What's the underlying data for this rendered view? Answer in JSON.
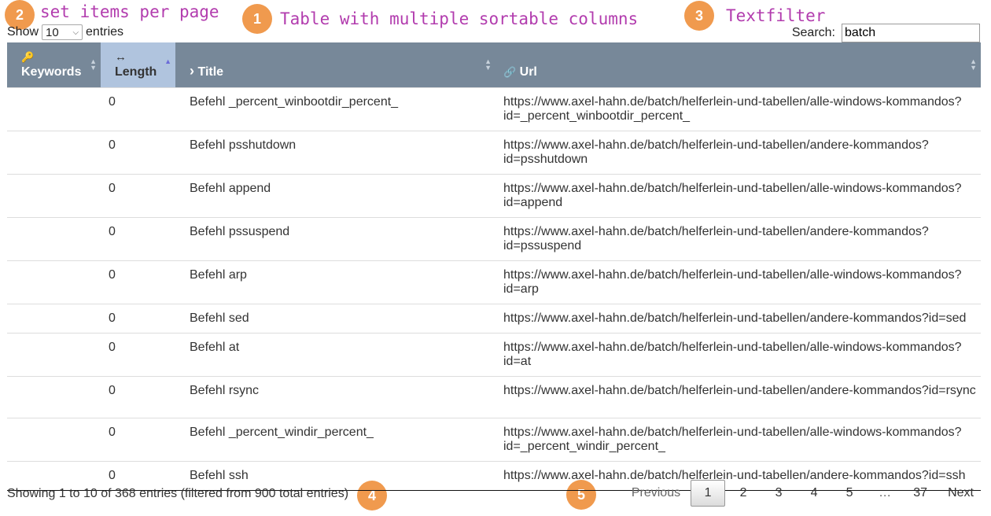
{
  "annotations": [
    {
      "num": "2",
      "text": "set items per page"
    },
    {
      "num": "1",
      "text": "Table with multiple sortable columns"
    },
    {
      "num": "3",
      "text": "Textfilter"
    },
    {
      "num": "4",
      "text": ""
    },
    {
      "num": "5",
      "text": ""
    }
  ],
  "length": {
    "label_pre": "Show",
    "value": "10",
    "label_post": "entries"
  },
  "search": {
    "label": "Search:",
    "value": "batch"
  },
  "columns": [
    {
      "label": "Keywords",
      "icon": "key-icon",
      "glyph": "🔑",
      "sorted": false
    },
    {
      "label": "Length",
      "icon": "arrows-h-icon",
      "glyph": "↔",
      "sorted": true
    },
    {
      "label": "Title",
      "icon": "chevron-right-icon",
      "glyph": "›",
      "sorted": false
    },
    {
      "label": "Url",
      "icon": "link-icon",
      "glyph": "🔗",
      "sorted": false
    }
  ],
  "rows": [
    {
      "keywords": "",
      "length": "0",
      "title": "Befehl _percent_winbootdir_percent_",
      "url": "https://www.axel-hahn.de/batch/helferlein-und-tabellen/alle-windows-kommandos?id=_percent_winbootdir_percent_"
    },
    {
      "keywords": "",
      "length": "0",
      "title": "Befehl psshutdown",
      "url": "https://www.axel-hahn.de/batch/helferlein-und-tabellen/andere-kommandos?id=psshutdown"
    },
    {
      "keywords": "",
      "length": "0",
      "title": "Befehl append",
      "url": "https://www.axel-hahn.de/batch/helferlein-und-tabellen/alle-windows-kommandos?id=append"
    },
    {
      "keywords": "",
      "length": "0",
      "title": "Befehl pssuspend",
      "url": "https://www.axel-hahn.de/batch/helferlein-und-tabellen/andere-kommandos?id=pssuspend"
    },
    {
      "keywords": "",
      "length": "0",
      "title": "Befehl arp",
      "url": "https://www.axel-hahn.de/batch/helferlein-und-tabellen/alle-windows-kommandos?id=arp"
    },
    {
      "keywords": "",
      "length": "0",
      "title": "Befehl sed",
      "url": "https://www.axel-hahn.de/batch/helferlein-und-tabellen/andere-kommandos?id=sed"
    },
    {
      "keywords": "",
      "length": "0",
      "title": "Befehl at",
      "url": "https://www.axel-hahn.de/batch/helferlein-und-tabellen/alle-windows-kommandos?id=at"
    },
    {
      "keywords": "",
      "length": "0",
      "title": "Befehl rsync",
      "url": "https://www.axel-hahn.de/batch/helferlein-und-tabellen/andere-kommandos?id=rsync"
    },
    {
      "keywords": "",
      "length": "0",
      "title": "Befehl _percent_windir_percent_",
      "url": "https://www.axel-hahn.de/batch/helferlein-und-tabellen/alle-windows-kommandos?id=_percent_windir_percent_"
    },
    {
      "keywords": "",
      "length": "0",
      "title": "Befehl ssh",
      "url": "https://www.axel-hahn.de/batch/helferlein-und-tabellen/andere-kommandos?id=ssh"
    }
  ],
  "info": "Showing 1 to 10 of 368 entries (filtered from 900 total entries)",
  "pagination": {
    "previous": "Previous",
    "pages": [
      "1",
      "2",
      "3",
      "4",
      "5"
    ],
    "ellipsis": "…",
    "last": "37",
    "next": "Next",
    "current": "1"
  },
  "colors": {
    "header_bg": "#778899",
    "sorted_header_bg": "#b0c4de",
    "badge": "#f09a4e",
    "annotation_text": "#b23cae"
  }
}
